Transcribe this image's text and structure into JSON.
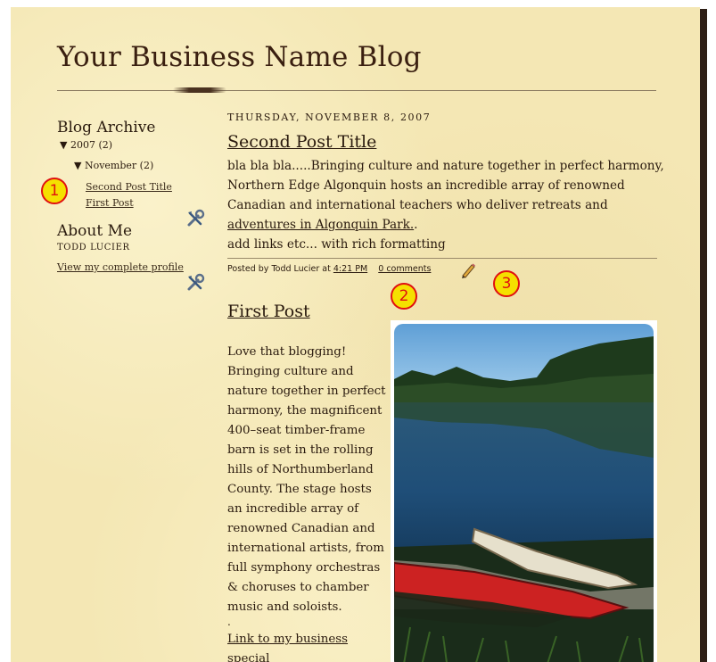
{
  "blog": {
    "title": "Your Business Name Blog"
  },
  "sidebar": {
    "archive_heading": "Blog Archive",
    "year_label": "▼ 2007 (2)",
    "month_label": "▼ November (2)",
    "posts": [
      "Second Post Title",
      "First Post"
    ],
    "about_heading": "About Me",
    "author_name": "TODD LUCIER",
    "profile_link": "View my complete profile"
  },
  "main": {
    "date_header": "THURSDAY, NOVEMBER 8, 2007",
    "post1": {
      "title": "Second Post Title",
      "body_text": "bla bla bla.....Bringing culture and nature together in perfect harmony, Northern Edge Algonquin hosts an incredible array of renowned Canadian and international teachers who deliver retreats and ",
      "body_link": "adventures in Algonquin Park.",
      "body_after_link": ".",
      "body_line2": "add links etc... with rich formatting",
      "footer_prefix": "Posted by Todd Lucier at ",
      "time": "4:21 PM",
      "comments": "0 comments"
    },
    "post2": {
      "title": "First Post",
      "body": "Love that blogging! Bringing culture and nature together in perfect harmony, the magnificent 400–seat timber-frame barn is set in the rolling hills of Northumberland County. The stage hosts an incredible array of renowned Canadian and international artists, from full symphony orchestras & choruses to chamber music and soloists.",
      "dot": ".",
      "link": "Link to my business",
      "link_cont": "special"
    }
  },
  "markers": [
    "1",
    "2",
    "3"
  ],
  "icons": {
    "edit_tools": "tools-icon",
    "edit_post": "pencil-icon"
  },
  "colors": {
    "page_bg": "#f4e7b4",
    "marker_fill": "#f5e000",
    "marker_ring": "#e01010",
    "text": "#2a1a0e"
  }
}
